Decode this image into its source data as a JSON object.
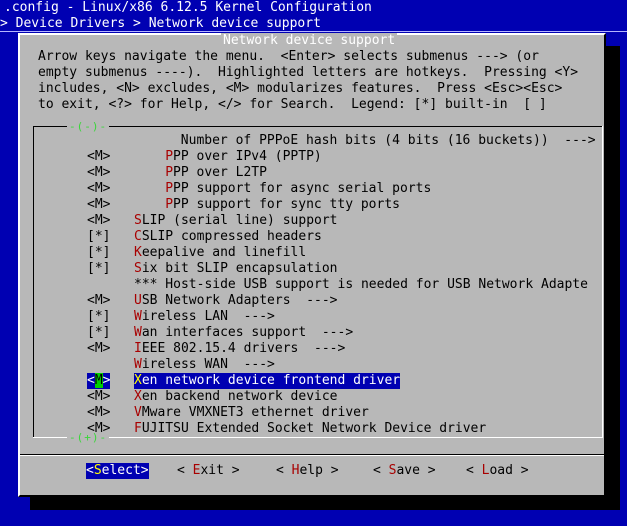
{
  "header": {
    "title": ".config - Linux/x86 6.12.5 Kernel Configuration",
    "breadcrumb": "> Device Drivers > Network device support"
  },
  "dialog": {
    "title": "Network device support",
    "help_lines": [
      "Arrow keys navigate the menu.  <Enter> selects submenus ---> (or",
      "empty submenus ----).  Highlighted letters are hotkeys.  Pressing <Y>",
      "includes, <N> excludes, <M> modularizes features.  Press <Esc><Esc>",
      "to exit, <?> for Help, </> for Search.  Legend: [*] built-in  [ ]"
    ],
    "scroll_up_indicator": "-(-)-",
    "scroll_down_indicator": "-(+)-"
  },
  "menu": {
    "items": [
      {
        "mark": "",
        "hotkey": "",
        "rest": "Number of PPPoE hash bits (4 bits (16 buckets))  --->",
        "indent": 3
      },
      {
        "mark": "<M>",
        "hotkey": "P",
        "rest": "PP over IPv4 (PPTP)",
        "indent": 2
      },
      {
        "mark": "<M>",
        "hotkey": "P",
        "rest": "PP over L2TP",
        "indent": 2
      },
      {
        "mark": "<M>",
        "hotkey": "P",
        "rest": "PP support for async serial ports",
        "indent": 2
      },
      {
        "mark": "<M>",
        "hotkey": "P",
        "rest": "PP support for sync tty ports",
        "indent": 2
      },
      {
        "mark": "<M>",
        "hotkey": "S",
        "rest": "LIP (serial line) support",
        "indent": 0
      },
      {
        "mark": "[*]",
        "hotkey": "C",
        "rest": "SLIP compressed headers",
        "indent": 0
      },
      {
        "mark": "[*]",
        "hotkey": "K",
        "rest": "eepalive and linefill",
        "indent": 0
      },
      {
        "mark": "[*]",
        "hotkey": "S",
        "rest": "ix bit SLIP encapsulation",
        "indent": 0
      },
      {
        "mark": "",
        "hotkey": "",
        "rest": "*** Host-side USB support is needed for USB Network Adapte",
        "indent": 0
      },
      {
        "mark": "<M>",
        "hotkey": "U",
        "rest": "SB Network Adapters  --->",
        "indent": 0
      },
      {
        "mark": "[*]",
        "hotkey": "W",
        "rest": "ireless LAN  --->",
        "indent": 0
      },
      {
        "mark": "[*]",
        "hotkey": "W",
        "rest": "an interfaces support  --->",
        "indent": 0
      },
      {
        "mark": "<M>",
        "hotkey": "I",
        "rest": "EEE 802.15.4 drivers  --->",
        "indent": 0
      },
      {
        "mark": "",
        "hotkey": "W",
        "rest": "ireless WAN  --->",
        "indent": 0
      },
      {
        "mark": "<M>",
        "hotkey": "X",
        "rest": "en network device frontend driver",
        "indent": 0,
        "selected": true
      },
      {
        "mark": "<M>",
        "hotkey": "X",
        "rest": "en backend network device",
        "indent": 0
      },
      {
        "mark": "<M>",
        "hotkey": "V",
        "rest": "Mware VMXNET3 ethernet driver",
        "indent": 0
      },
      {
        "mark": "<M>",
        "hotkey": "F",
        "rest": "UJITSU Extended Socket Network Device driver",
        "indent": 0
      }
    ]
  },
  "buttons": [
    {
      "pre": "<",
      "hotkey": "S",
      "post": "elect>",
      "selected": true
    },
    {
      "pre": "< ",
      "hotkey": "E",
      "post": "xit >",
      "selected": false
    },
    {
      "pre": "< ",
      "hotkey": "H",
      "post": "elp >",
      "selected": false
    },
    {
      "pre": "< ",
      "hotkey": "S",
      "post": "ave >",
      "selected": false
    },
    {
      "pre": "< ",
      "hotkey": "L",
      "post": "oad >",
      "selected": false
    }
  ],
  "colors": {
    "background": "#0000b2",
    "dialog": "#b8b8b8",
    "hotkey": "#a80000",
    "selected_bg": "#0000b2",
    "selected_hotkey": "#ffff00",
    "scroll_indicator": "#3bd63b"
  }
}
